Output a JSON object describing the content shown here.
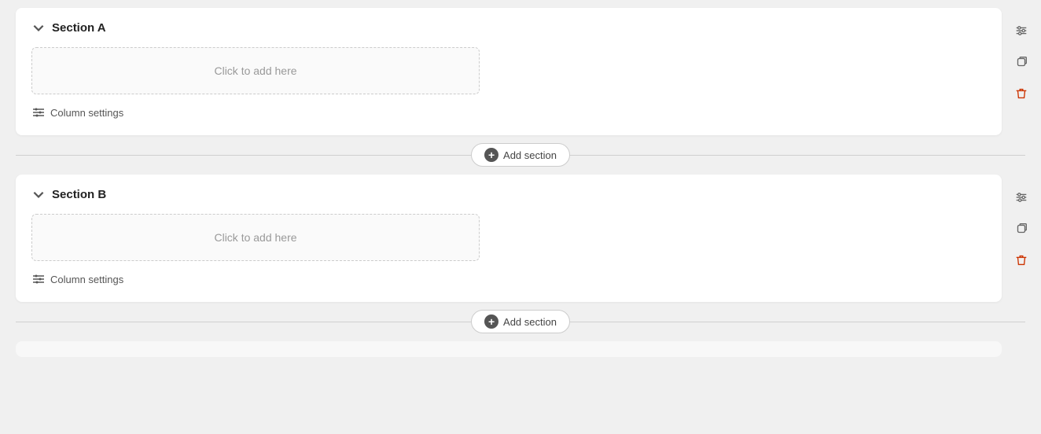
{
  "sections": [
    {
      "id": "section-a",
      "title": "Section A",
      "add_content_placeholder": "Click to add here",
      "column_settings_label": "Column settings"
    },
    {
      "id": "section-b",
      "title": "Section B",
      "add_content_placeholder": "Click to add here",
      "column_settings_label": "Column settings"
    }
  ],
  "add_section_label": "Add section",
  "icons": {
    "settings": "⚙",
    "collapse": "∨",
    "delete": "🗑",
    "plus": "+"
  }
}
